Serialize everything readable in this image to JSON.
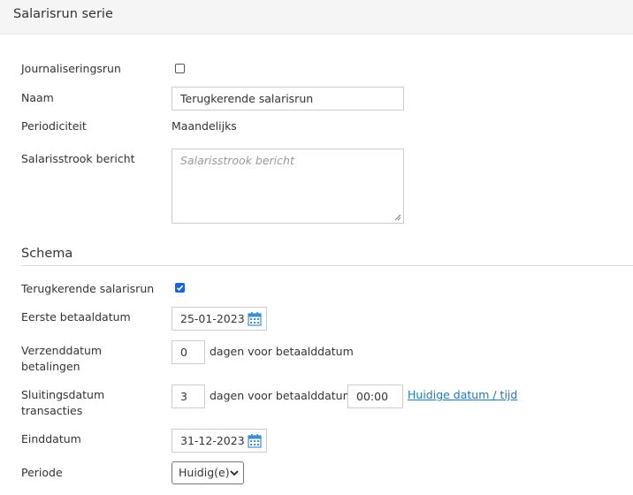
{
  "header": {
    "title": "Salarisrun serie"
  },
  "form": {
    "journalisering": {
      "label": "Journaliseringsrun",
      "checked": false
    },
    "naam": {
      "label": "Naam",
      "value": "Terugkerende salarisrun"
    },
    "periodiciteit": {
      "label": "Periodiciteit",
      "value": "Maandelijks"
    },
    "salarisstrook": {
      "label": "Salarisstrook bericht",
      "placeholder": "Salarisstrook bericht"
    }
  },
  "schema": {
    "title": "Schema",
    "terugkerend": {
      "label": "Terugkerende salarisrun",
      "checked": true
    },
    "eerste_betaaldatum": {
      "label": "Eerste betaaldatum",
      "value": "25-01-2023"
    },
    "verzenddatum": {
      "label_line1": "Verzenddatum",
      "label_line2": "betalingen",
      "value": "0",
      "suffix": "dagen voor betaalddatum"
    },
    "sluitingsdatum": {
      "label_line1": "Sluitingsdatum",
      "label_line2": "transacties",
      "value": "3",
      "suffix": "dagen voor betaalddatum",
      "time_value": "00:00",
      "link": "Huidige datum / tijd"
    },
    "einddatum": {
      "label": "Einddatum",
      "value": "31-12-2023"
    },
    "periode": {
      "label": "Periode",
      "selected": "Huidig(e)"
    }
  },
  "colors": {
    "accent": "#1a66d6",
    "link": "#1f77b4",
    "calendar": "#3a8fd0"
  },
  "icons": {
    "calendar": "calendar-icon",
    "dropdown": "chevron-down-icon"
  }
}
